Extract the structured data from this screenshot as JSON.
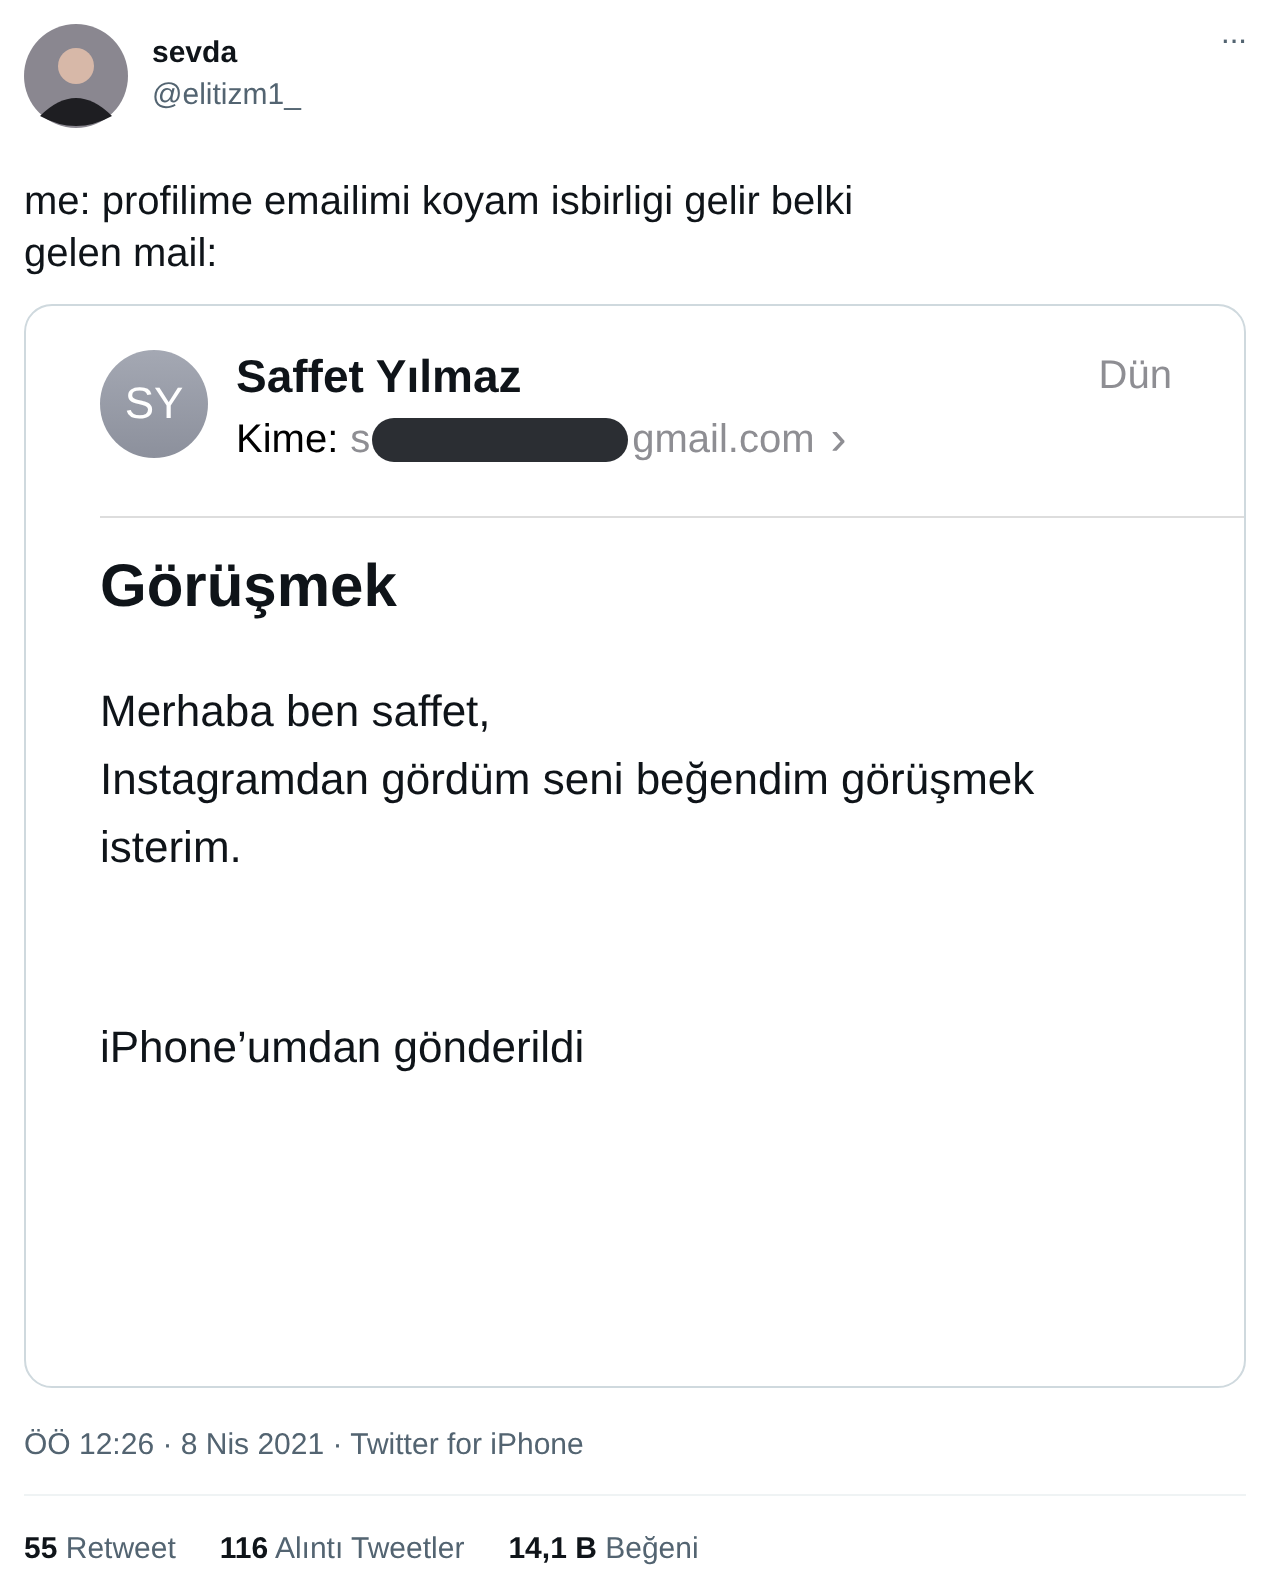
{
  "tweet": {
    "author": {
      "name": "sevda",
      "handle": "@elitizm1_"
    },
    "more": "···",
    "text": "me: profilime emailimi koyam isbirligi gelir belki\ngelen mail:",
    "email": {
      "initials": "SY",
      "sender": "Saffet Yılmaz",
      "to_label": "Kime:",
      "to_start": "s",
      "to_end": "gmail.com",
      "chevron": "›",
      "date": "Dün",
      "subject": "Görüşmek",
      "body": "Merhaba ben saffet,\nInstagramdan gördüm seni beğendim görüşmek\nisterim.",
      "signature": "iPhone’umdan gönderildi"
    },
    "meta": "ÖÖ 12:26 · 8 Nis 2021 · Twitter for iPhone",
    "stats": [
      {
        "count": "55",
        "label": "Retweet"
      },
      {
        "count": "116",
        "label": "Alıntı Tweetler"
      },
      {
        "count": "14,1 B",
        "label": "Beğeni"
      }
    ]
  }
}
